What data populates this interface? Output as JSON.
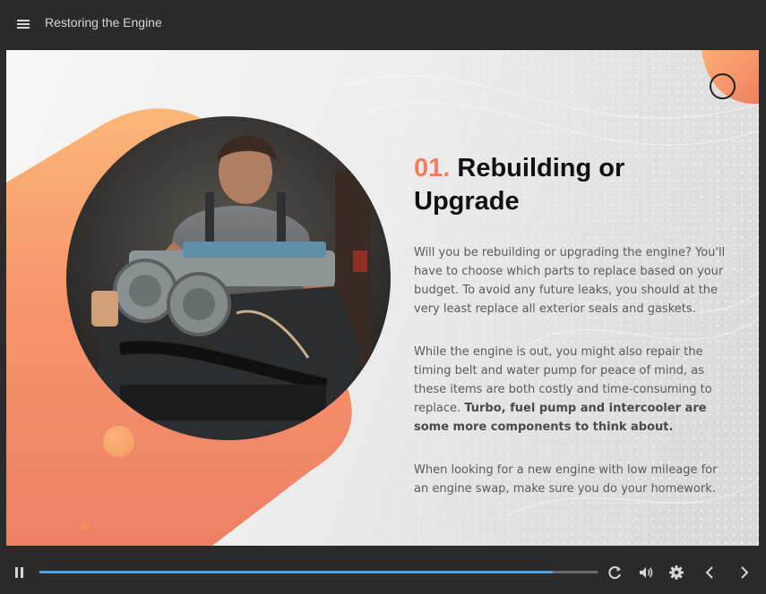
{
  "header": {
    "course_title": "Restoring the Engine"
  },
  "slide": {
    "heading_number": "01.",
    "heading_text": "Rebuilding or Upgrade",
    "paragraph1": "Will you be rebuilding or upgrading the engine? You'll have to choose which parts to replace based on your budget. To avoid any future leaks, you should at the very least replace all exterior seals and gaskets.",
    "paragraph2_regular": "While the engine is out, you might also repair the timing belt and water pump for peace of mind, as these items are both costly and time-consuming to replace.",
    "paragraph2_bold": "Turbo, fuel pump and intercooler are some more components to think about.",
    "paragraph3": "When looking for a new engine with low mileage for an engine swap, make sure you do your homework."
  },
  "controls": {
    "progress_fraction": 0.92
  },
  "icons": {
    "menu": "hamburger-menu-icon",
    "play_pause": "pause-icon",
    "replay": "replay-icon",
    "volume": "volume-icon",
    "settings": "gear-icon",
    "prev": "chevron-left-icon",
    "next": "chevron-right-icon"
  },
  "colors": {
    "accent_orange": "#ee8062",
    "progress_blue": "#4fa3e0",
    "chrome_dark": "#2b2b2b"
  }
}
